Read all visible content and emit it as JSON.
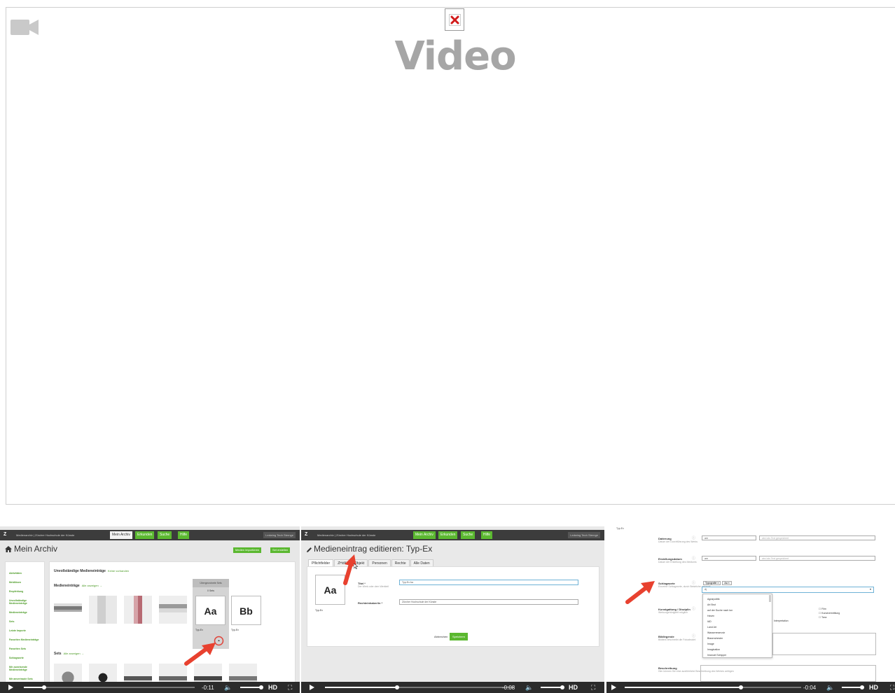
{
  "video": {
    "title": "Video",
    "camera_icon": "video-camera-icon",
    "broken_image_icon": "broken-image-icon"
  },
  "thumbnails": [
    {
      "app": {
        "logo": "Z",
        "site_title": "Medienarchiv | Zürcher Hochschule der Künste",
        "nav": [
          "Mein Archiv",
          "Erkunden",
          "Suche",
          "Hilfe"
        ],
        "user": "Ledwing Teoh Sternge"
      },
      "page_title": "Mein Archiv",
      "buttons": [
        "Medien importieren",
        "Set erstellen"
      ],
      "sidebar": [
        "Aktivitäten",
        "Meldlösen",
        "Empfehlung",
        "Unvollständige Medieneinträge",
        "Medieneinträge",
        "Sets",
        "Letzte Importe",
        "Favoriten Medieneinträge",
        "Favoriten Sets",
        "Schlagworte",
        "Mir zuweisende Medieneinträge",
        "Mir anvertraute Sets"
      ],
      "section_incomplete": "Unvollständige Medieneinträge",
      "section_incomplete_note": "Keine vorhanden",
      "section_media": "Medieneinträge",
      "section_media_link": "Alle anzeigen →",
      "section_sets": "Sets",
      "section_sets_link": "Alle anzeigen →",
      "popup_label": "Übergeordnete Sets",
      "popup_sub": "0 Sets",
      "card_a": "Aa",
      "card_b": "Bb",
      "card_caption": "Typ-Ex",
      "controls": {
        "time": "-0:11",
        "hd": "HD",
        "progress": 0.12
      }
    },
    {
      "app": {
        "logo": "Z",
        "site_title": "Medienarchiv | Zürcher Hochschule der Künste",
        "nav": [
          "Mein Archiv",
          "Erkunden",
          "Suche",
          "Hilfe"
        ],
        "user": "Ledwing Teoh Sternge"
      },
      "page_title": "Medieneintrag editieren: Typ-Ex",
      "tabs": [
        "Pflichtfelder",
        "ZHdK",
        "Objekt",
        "Personen",
        "Rechte",
        "Alle Daten"
      ],
      "card_a": "Aa",
      "card_caption": "Typ-Ex",
      "field_title_label": "Titel *",
      "field_title_hint": "Der Werk oder dem Werkteil",
      "field_title_value": "Typ-Ex Aa",
      "field_rights_label": "Rechteinhaber/in *",
      "field_rights_value": "Zürcher Hochschule der Künste",
      "cancel": "Abbrechen",
      "save": "Speichern",
      "controls": {
        "time": "-0:08",
        "hd": "HD",
        "progress": 0.38
      }
    },
    {
      "header": "Typ-Ex",
      "fields": [
        {
          "label": "Datierung",
          "hint": "Datum der Durchführung des Werks",
          "select": "am",
          "note": "wird als Text gespeichert"
        },
        {
          "label": "Erstellungsdatum",
          "hint": "Datum der Erstellung des Mediums",
          "select": "am",
          "note": "wird als Text gespeichert"
        }
      ],
      "keywords_label": "Schlagworte",
      "keywords_hint": "Einzelne Schlagworte, durch Beistriche getrennt",
      "tags": [
        "Typografie ×",
        "Aa ×"
      ],
      "keyword_input": "A|",
      "suggestions": [
        "Agrarpolitik",
        "Art Brut",
        "auf der Suche nach ton",
        "Haven",
        "IAD",
        "Land Art",
        "Wasserreservoir",
        "Blasenchester",
        "Image",
        "Imagination",
        "Imanuel Schipper"
      ],
      "genre_label": "Kunstgattung / Disziplin",
      "genre_hint": "Werkzugehörigkeit möglich",
      "genre_options": [
        "Film",
        "Kunstvermittlung",
        "Tanz"
      ],
      "genre_partial": "Interpretation",
      "legend_label": "Bildlegende",
      "legend_hint": "Bildtext beschreibt die Fotoabsicht",
      "desc_label": "Beschreibung",
      "desc_hint": "Hier können Sie eine ausführliche Beschreibung des Werkes anfügen",
      "controls": {
        "time": "-0:04",
        "hd": "HD",
        "progress": 0.66
      }
    }
  ]
}
